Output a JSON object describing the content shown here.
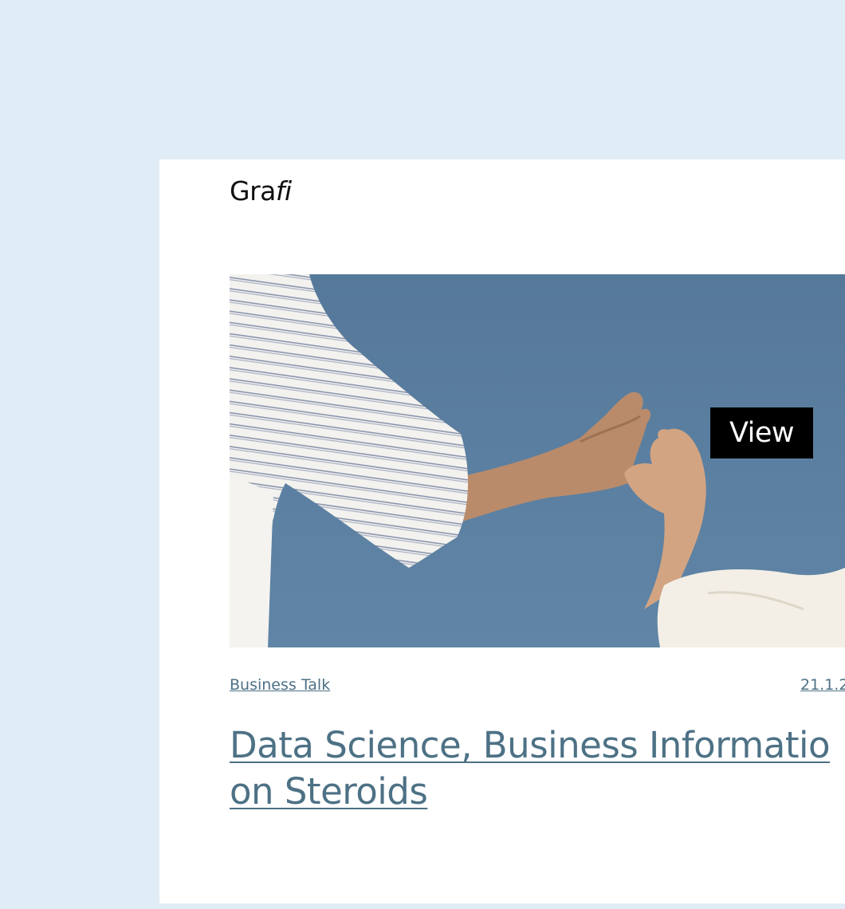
{
  "brand": {
    "logo_regular": "Gra",
    "logo_italic": "fi"
  },
  "post": {
    "view_label": "View",
    "category": "Business Talk",
    "date": "21.1.2",
    "title_line1": "Data Science, Business Informatio",
    "title_line2": "on Steroids"
  },
  "colors": {
    "page_background": "#e1edf6",
    "card_background": "#ffffff",
    "accent_text": "#4d7185",
    "sky": "#5b7f9f",
    "button": "#000000"
  },
  "icons": {
    "hero_image": "hands-reaching-photo"
  }
}
